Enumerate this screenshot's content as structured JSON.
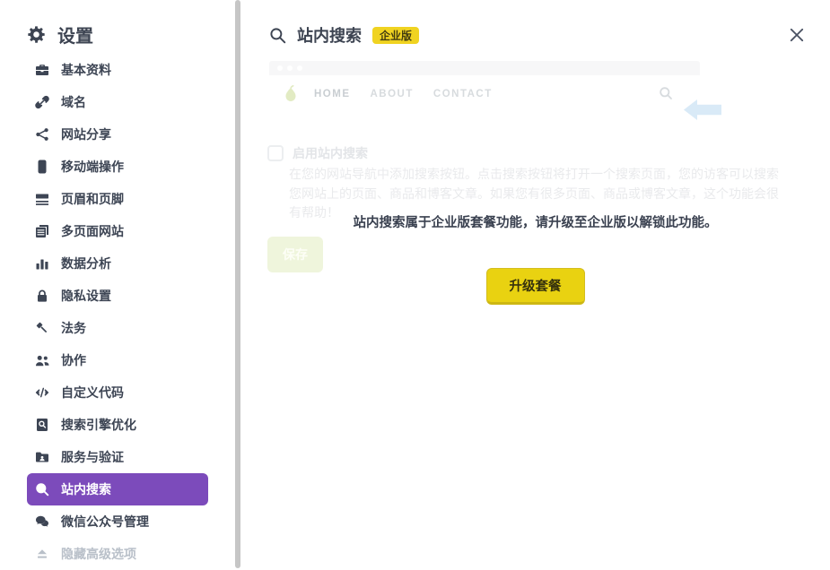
{
  "sidebar": {
    "title": "设置",
    "items": [
      {
        "label": "基本资料",
        "icon": "briefcase-icon"
      },
      {
        "label": "域名",
        "icon": "link-icon"
      },
      {
        "label": "网站分享",
        "icon": "share-icon"
      },
      {
        "label": "移动端操作",
        "icon": "mobile-icon"
      },
      {
        "label": "页眉和页脚",
        "icon": "header-footer-icon"
      },
      {
        "label": "多页面网站",
        "icon": "pages-icon"
      },
      {
        "label": "数据分析",
        "icon": "bar-chart-icon"
      },
      {
        "label": "隐私设置",
        "icon": "lock-icon"
      },
      {
        "label": "法务",
        "icon": "gavel-icon"
      },
      {
        "label": "协作",
        "icon": "people-icon"
      },
      {
        "label": "自定义代码",
        "icon": "code-icon"
      },
      {
        "label": "搜索引擎优化",
        "icon": "doc-search-icon"
      },
      {
        "label": "服务与验证",
        "icon": "folder-user-icon"
      },
      {
        "label": "站内搜索",
        "icon": "search-icon",
        "active": true
      },
      {
        "label": "微信公众号管理",
        "icon": "wechat-icon"
      },
      {
        "label": "隐藏高级选项",
        "icon": "eject-icon",
        "muted": true
      }
    ]
  },
  "header": {
    "title": "站内搜索",
    "badge": "企业版"
  },
  "preview": {
    "nav_links": [
      "HOME",
      "ABOUT",
      "CONTACT"
    ]
  },
  "form": {
    "checkbox_label": "启用站内搜索",
    "description": "在您的网站导航中添加搜索按钮。点击搜索按钮将打开一个搜索页面，您的访客可以搜索您网站上的页面、商品和博客文章。如果您有很多页面、商品或博客文章，这个功能会很有帮助！",
    "save_label": "保存"
  },
  "upgrade": {
    "message": "站内搜索属于企业版套餐功能，请升级至企业版以解锁此功能。",
    "button_label": "升级套餐"
  },
  "colors": {
    "accent_purple": "#7c4bbb",
    "badge_yellow": "#f0d321",
    "button_yellow": "#e9d211",
    "text_dark": "#3d4554",
    "muted_gray": "#b9c0c9",
    "arrow_blue": "#d9eaf7",
    "logo_green": "#e2ebc3"
  }
}
